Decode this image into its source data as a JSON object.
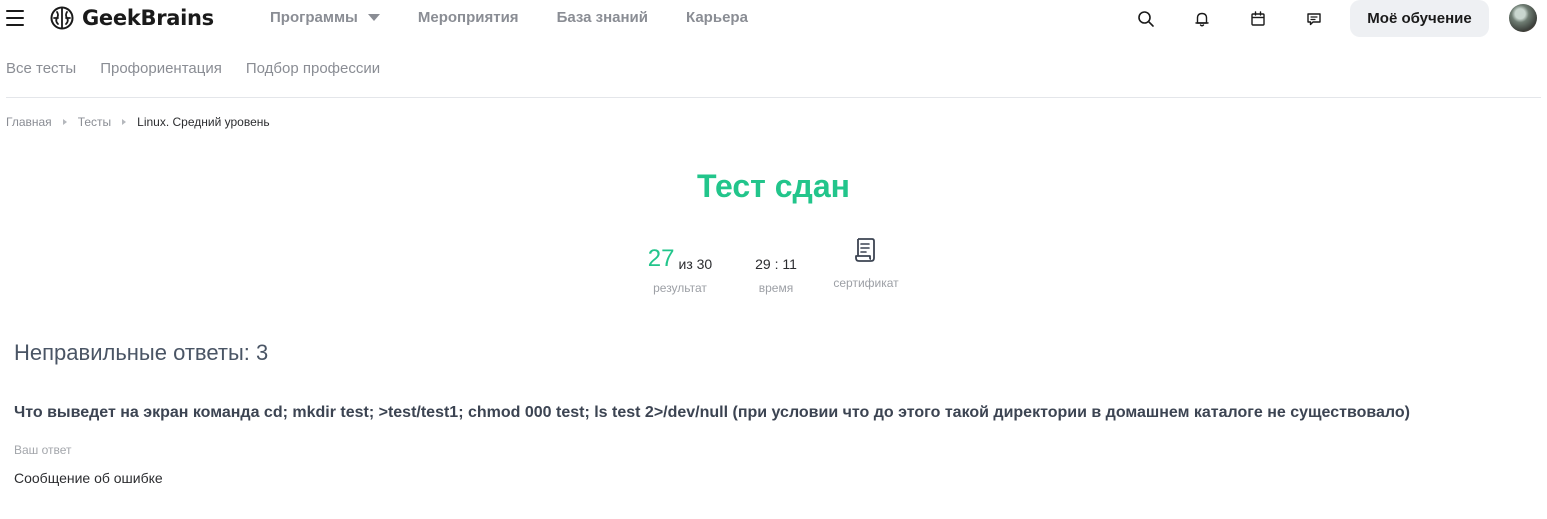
{
  "header": {
    "logo_text": "GeekBrains",
    "nav": [
      {
        "label": "Программы",
        "has_dropdown": true
      },
      {
        "label": "Мероприятия"
      },
      {
        "label": "База знаний"
      },
      {
        "label": "Карьера"
      }
    ],
    "icons": [
      "search-icon",
      "bell-icon",
      "calendar-icon",
      "chat-icon"
    ],
    "my_learning_label": "Моё обучение"
  },
  "subnav": {
    "items": [
      "Все тесты",
      "Профориентация",
      "Подбор профессии"
    ]
  },
  "breadcrumb": {
    "items": [
      "Главная",
      "Тесты",
      "Linux. Средний уровень"
    ]
  },
  "result": {
    "title": "Тест сдан",
    "score": "27",
    "score_total": "из 30",
    "score_label": "результат",
    "time": "29 : 11",
    "time_label": "время",
    "certificate_label": "сертификат"
  },
  "wrong_answers": {
    "title": "Неправильные ответы: 3",
    "question": "Что выведет на экран команда cd; mkdir test; >test/test1; chmod 000 test; ls test 2>/dev/null (при условии что до этого такой директории в домашнем каталоге не существовало)",
    "answer_label": "Ваш ответ",
    "answer_value": "Сообщение об ошибке"
  },
  "colors": {
    "accent_green": "#22c58b",
    "nav_gray": "#8a8d94",
    "button_bg": "#eef0f3"
  }
}
